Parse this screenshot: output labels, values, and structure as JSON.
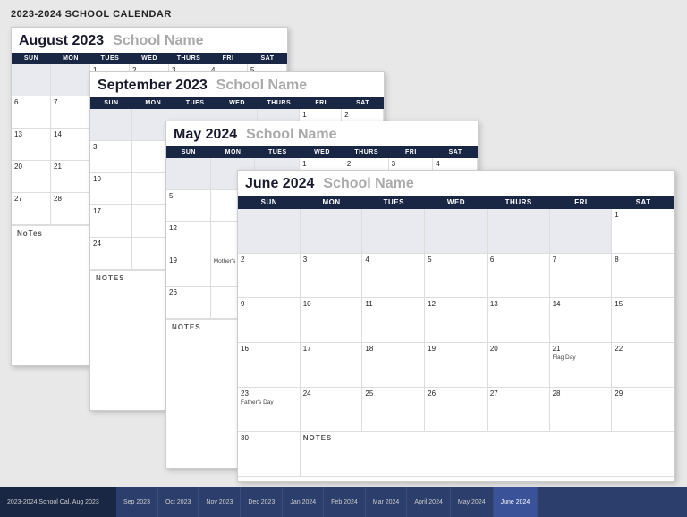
{
  "appTitle": "2023-2024 SCHOOL CALENDAR",
  "calendars": {
    "august": {
      "title": "August 2023",
      "schoolName": "School Name",
      "days": [
        "SUN",
        "MON",
        "TUES",
        "WED",
        "THURS",
        "FRI",
        "SAT"
      ],
      "rows": [
        [
          "",
          "",
          "1",
          "2",
          "3",
          "4",
          "5"
        ],
        [
          "6",
          "7",
          "",
          "",
          "",
          "",
          ""
        ],
        [
          "13",
          "14",
          "",
          "",
          "",
          "",
          ""
        ],
        [
          "20",
          "21",
          "",
          "",
          "",
          "",
          ""
        ],
        [
          "27",
          "28",
          "",
          "",
          "",
          "",
          ""
        ]
      ],
      "notesLabel": "NOTES"
    },
    "september": {
      "title": "September 2023",
      "schoolName": "School Name",
      "days": [
        "SUN",
        "MON",
        "TUES",
        "WED",
        "THURS",
        "FRI",
        "SAT"
      ],
      "rows": [
        [
          "",
          "",
          "",
          "",
          "",
          "1",
          "2"
        ],
        [
          "3",
          "",
          "",
          "",
          "",
          "",
          ""
        ],
        [
          "10",
          "",
          "",
          "",
          "",
          "",
          ""
        ],
        [
          "17",
          "",
          "",
          "",
          "",
          "",
          ""
        ],
        [
          "24",
          "",
          "",
          "",
          "",
          "",
          ""
        ]
      ],
      "notesLabel": "NOTES"
    },
    "may": {
      "title": "May 2024",
      "schoolName": "School Name",
      "days": [
        "SUN",
        "MON",
        "TUES",
        "WED",
        "THURS",
        "FRI",
        "SAT"
      ],
      "rows": [
        [
          "",
          "",
          "",
          "1",
          "2",
          "3",
          "4"
        ],
        [
          "5",
          "",
          "",
          "",
          "",
          "",
          ""
        ],
        [
          "12",
          "",
          "",
          "",
          "",
          "",
          ""
        ],
        [
          "19",
          "",
          "",
          "",
          "",
          "",
          ""
        ],
        [
          "26",
          "",
          "",
          "",
          "",
          "",
          ""
        ]
      ],
      "events": {
        "19-1": "Mother's Day"
      },
      "notesLabel": "NOTES"
    },
    "june": {
      "title": "June 2024",
      "schoolName": "School Name",
      "days": [
        "SUN",
        "MON",
        "TUES",
        "WED",
        "THURS",
        "FRI",
        "SAT"
      ],
      "rows": [
        [
          "",
          "",
          "",
          "",
          "",
          "",
          "1"
        ],
        [
          "2",
          "3",
          "4",
          "5",
          "6",
          "7",
          "8"
        ],
        [
          "9",
          "10",
          "11",
          "12",
          "13",
          "14",
          "15"
        ],
        [
          "16",
          "17",
          "18",
          "19",
          "20",
          "21",
          "22"
        ],
        [
          "23",
          "24",
          "25",
          "26",
          "27",
          "28",
          "29"
        ],
        [
          "30",
          "",
          "",
          "",
          "",
          "",
          ""
        ]
      ],
      "events": {
        "r4c6": "Flag Day",
        "r5c1": "Father's Day"
      },
      "notesLabel": "NOTES"
    }
  },
  "tabs": {
    "leftLabel": "2023-2024 School Cal. Aug 2023",
    "items": [
      {
        "label": "Sep 2023",
        "active": false
      },
      {
        "label": "Oct 2023",
        "active": false
      },
      {
        "label": "Nov 2023",
        "active": false
      },
      {
        "label": "Dec 2023",
        "active": false
      },
      {
        "label": "Jan 2024",
        "active": false
      },
      {
        "label": "Feb 2024",
        "active": false
      },
      {
        "label": "Mar 2024",
        "active": false
      },
      {
        "label": "April 2024",
        "active": false
      },
      {
        "label": "May 2024",
        "active": false
      },
      {
        "label": "June 2024",
        "active": true
      }
    ]
  },
  "bigNotesLabel": "NoTes"
}
